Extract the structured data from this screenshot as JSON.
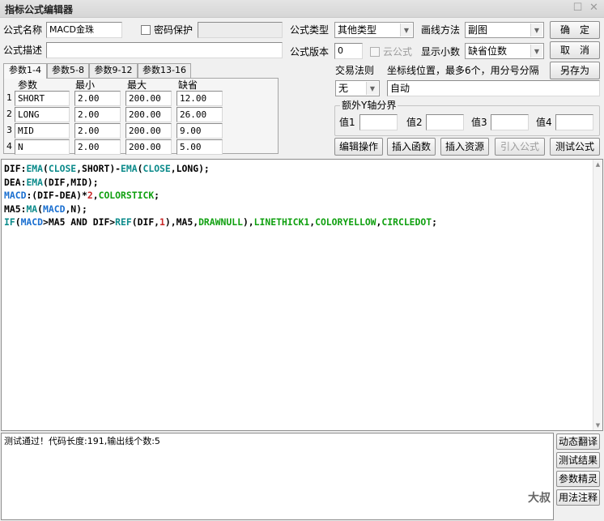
{
  "window": {
    "title": "指标公式编辑器",
    "restore_glyph": "☐",
    "close_glyph": "✕"
  },
  "top": {
    "name_label": "公式名称",
    "name_value": "MACD金珠",
    "password_label": "密码保护",
    "desc_label": "公式描述",
    "desc_value": "",
    "type_label": "公式类型",
    "type_value": "其他类型",
    "draw_label": "画线方法",
    "draw_value": "副图",
    "version_label": "公式版本",
    "version_value": "0",
    "cloud_label": "云公式",
    "decimals_label": "显示小数",
    "decimals_value": "缺省位数",
    "ok_button": "确　定",
    "cancel_button": "取　消",
    "saveas_button": "另存为"
  },
  "tabs": [
    "参数1-4",
    "参数5-8",
    "参数9-12",
    "参数13-16"
  ],
  "params": {
    "headers": [
      "参数",
      "最小",
      "最大",
      "缺省"
    ],
    "rows": [
      {
        "n": "1",
        "name": "SHORT",
        "min": "2.00",
        "max": "200.00",
        "default": "12.00"
      },
      {
        "n": "2",
        "name": "LONG",
        "min": "2.00",
        "max": "200.00",
        "default": "26.00"
      },
      {
        "n": "3",
        "name": "MID",
        "min": "2.00",
        "max": "200.00",
        "default": "9.00"
      },
      {
        "n": "4",
        "name": "N",
        "min": "2.00",
        "max": "200.00",
        "default": "5.00"
      }
    ]
  },
  "trade": {
    "rule_label": "交易法则",
    "rule_value": "无",
    "coord_label": "坐标线位置，最多6个，用分号分隔",
    "coord_value": "自动",
    "yaxis_group": "额外Y轴分界",
    "val_labels": [
      "值1",
      "值2",
      "值3",
      "值4"
    ]
  },
  "actions": {
    "edit_ops": "编辑操作",
    "insert_func": "插入函数",
    "insert_res": "插入资源",
    "import_formula": "引入公式",
    "test_formula": "测试公式"
  },
  "code_lines": [
    [
      [
        "DIF",
        "c-var"
      ],
      [
        ":",
        "c-op"
      ],
      [
        "EMA",
        "c-fn"
      ],
      [
        "(",
        "c-op"
      ],
      [
        "CLOSE",
        "c-fn"
      ],
      [
        ",SHORT)-",
        "c-op"
      ],
      [
        "EMA",
        "c-fn"
      ],
      [
        "(",
        "c-op"
      ],
      [
        "CLOSE",
        "c-fn"
      ],
      [
        ",LONG);",
        "c-op"
      ]
    ],
    [
      [
        "DEA",
        "c-var"
      ],
      [
        ":",
        "c-op"
      ],
      [
        "EMA",
        "c-fn"
      ],
      [
        "(DIF,MID);",
        "c-op"
      ]
    ],
    [
      [
        "MACD",
        "c-out"
      ],
      [
        ":(DIF-DEA)*",
        "c-op"
      ],
      [
        "2",
        "c-num"
      ],
      [
        ",",
        "c-op"
      ],
      [
        "COLORSTICK",
        "c-kw"
      ],
      [
        ";",
        "c-op"
      ]
    ],
    [
      [
        "MA5",
        "c-var"
      ],
      [
        ":",
        "c-op"
      ],
      [
        "MA",
        "c-fn"
      ],
      [
        "(",
        "c-op"
      ],
      [
        "MACD",
        "c-out"
      ],
      [
        ",N);",
        "c-op"
      ]
    ],
    [
      [
        "IF",
        "c-fn"
      ],
      [
        "(",
        "c-op"
      ],
      [
        "MACD",
        "c-out"
      ],
      [
        ">MA5 AND DIF>",
        "c-op"
      ],
      [
        "REF",
        "c-fn"
      ],
      [
        "(DIF,",
        "c-op"
      ],
      [
        "1",
        "c-num"
      ],
      [
        "),MA5,",
        "c-op"
      ],
      [
        "DRAWNULL",
        "c-kw"
      ],
      [
        "),",
        "c-op"
      ],
      [
        "LINETHICK1",
        "c-kw"
      ],
      [
        ",",
        "c-op"
      ],
      [
        "COLORYELLOW",
        "c-kw"
      ],
      [
        ",",
        "c-op"
      ],
      [
        "CIRCLEDOT",
        "c-kw"
      ],
      [
        ";",
        "c-op"
      ]
    ]
  ],
  "output": {
    "message": "测试通过！代码长度:191,输出线个数:5"
  },
  "side_buttons": [
    "动态翻译",
    "测试结果",
    "参数精灵",
    "用法注释"
  ],
  "watermark": "大叔"
}
